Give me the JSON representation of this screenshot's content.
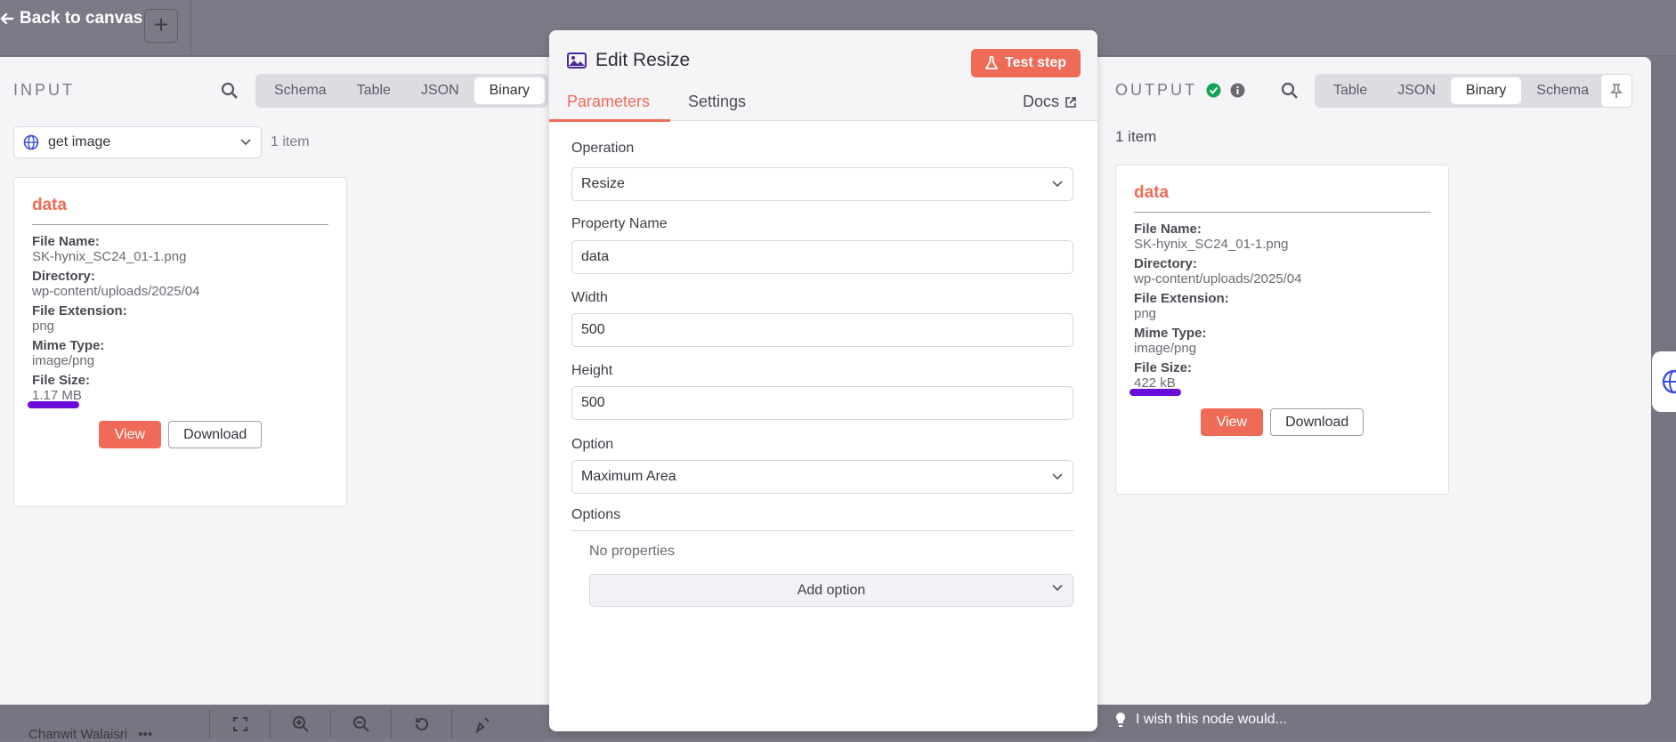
{
  "canvas": {
    "back_label": "Back to canvas",
    "add_label": "+",
    "user_name": "Chanwit Walaisri",
    "more_label": "•••",
    "wish_label": "I wish this node would..."
  },
  "input": {
    "label": "INPUT",
    "tabs": [
      "Schema",
      "Table",
      "JSON",
      "Binary"
    ],
    "active_tab": "Binary",
    "node_select": "get image",
    "item_count": "1 item",
    "card": {
      "title": "data",
      "file_name_label": "File Name:",
      "file_name": "SK-hynix_SC24_01-1.png",
      "directory_label": "Directory:",
      "directory": "wp-content/uploads/2025/04",
      "ext_label": "File Extension:",
      "ext": "png",
      "mime_label": "Mime Type:",
      "mime": "image/png",
      "size_label": "File Size:",
      "size": "1.17 MB",
      "view_label": "View",
      "download_label": "Download"
    }
  },
  "edit": {
    "title": "Edit Resize",
    "test_label": "Test step",
    "tab_parameters": "Parameters",
    "tab_settings": "Settings",
    "docs_label": "Docs",
    "operation_label": "Operation",
    "operation_value": "Resize",
    "property_label": "Property Name",
    "property_value": "data",
    "width_label": "Width",
    "width_value": "500",
    "height_label": "Height",
    "height_value": "500",
    "option_label": "Option",
    "option_value": "Maximum Area",
    "options_label": "Options",
    "no_props": "No properties",
    "add_option": "Add option"
  },
  "output": {
    "label": "OUTPUT",
    "tabs": [
      "Table",
      "JSON",
      "Binary",
      "Schema"
    ],
    "active_tab": "Binary",
    "item_count": "1 item",
    "card": {
      "title": "data",
      "file_name_label": "File Name:",
      "file_name": "SK-hynix_SC24_01-1.png",
      "directory_label": "Directory:",
      "directory": "wp-content/uploads/2025/04",
      "ext_label": "File Extension:",
      "ext": "png",
      "mime_label": "Mime Type:",
      "mime": "image/png",
      "size_label": "File Size:",
      "size": "422 kB",
      "view_label": "View",
      "download_label": "Download"
    }
  },
  "colors": {
    "accent": "#ef6b57",
    "marker": "#6a0dd8",
    "success": "#12a454"
  }
}
